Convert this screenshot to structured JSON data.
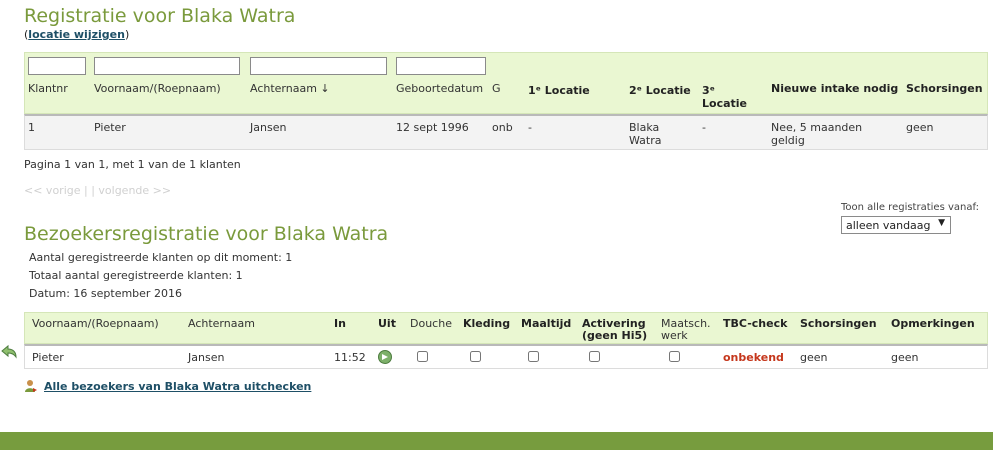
{
  "title": "Registratie voor Blaka Watra",
  "location_change": {
    "open": "(",
    "link": "locatie wijzigen",
    "close": ")"
  },
  "reg_table": {
    "headers": {
      "klantnr": "Klantnr",
      "voornaam": "Voornaam/(Roepnaam)",
      "achternaam": "Achternaam ↓",
      "geboortedatum": "Geboortedatum",
      "g": "G",
      "loc1": "1ᵉ Locatie",
      "loc2": "2ᵉ Locatie",
      "loc3_a": "3ᵉ",
      "loc3_b": "Locatie",
      "intake": "Nieuwe intake nodig",
      "schorsingen": "Schorsingen"
    },
    "row": {
      "klantnr": "1",
      "voornaam": "Pieter",
      "achternaam": "Jansen",
      "geboortedatum": "12 sept 1996",
      "g": "onb",
      "loc1": "-",
      "loc2_a": "Blaka",
      "loc2_b": "Watra",
      "loc3": "-",
      "intake_a": "Nee, 5 maanden",
      "intake_b": "geldig",
      "schorsingen": "geen"
    }
  },
  "pagination": {
    "text": "Pagina 1 van 1, met 1 van de 1 klanten",
    "nav": "<< vorige | | volgende >>"
  },
  "filter_select": {
    "label": "Toon alle registraties vanaf:",
    "value": "alleen vandaag"
  },
  "visitors_title": "Bezoekersregistratie voor Blaka Watra",
  "stats": {
    "registered": "Aantal geregistreerde klanten op dit moment: 1",
    "total": "Totaal aantal geregistreerde klanten: 1",
    "date": "Datum: 16 september 2016"
  },
  "visit_table": {
    "headers": {
      "voornaam": "Voornaam/(Roepnaam)",
      "achternaam": "Achternaam",
      "in": "In",
      "uit": "Uit",
      "douche": "Douche",
      "kleding": "Kleding",
      "maaltijd": "Maaltijd",
      "activering_a": "Activering",
      "activering_b": "(geen Hi5)",
      "maatsch_a": "Maatsch.",
      "maatsch_b": "werk",
      "tbc": "TBC-check",
      "schorsingen": "Schorsingen",
      "opmerkingen": "Opmerkingen"
    },
    "row": {
      "voornaam": "Pieter",
      "achternaam": "Jansen",
      "in": "11:52",
      "tbc": "onbekend",
      "schorsingen": "geen",
      "opmerkingen": "geen"
    }
  },
  "checkout_link": "Alle bezoekers van Blaka Watra uitchecken",
  "colors": {
    "accent": "#7a9a3c",
    "header_bg": "#eaf7d2",
    "footer": "#779c3e",
    "alert": "#c5371c",
    "link": "#1e4f66"
  }
}
